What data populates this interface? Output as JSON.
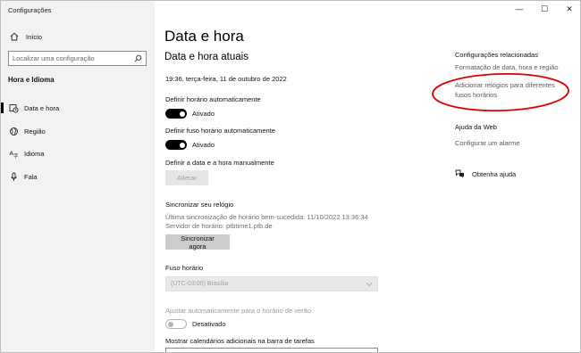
{
  "app": {
    "title": "Configurações"
  },
  "window_controls": {
    "minimize": "—",
    "maximize": "☐",
    "close": "✕"
  },
  "sidebar": {
    "home_label": "Início",
    "search_placeholder": "Localizar uma configuração",
    "section_title": "Hora e Idioma",
    "items": [
      {
        "label": "Data e hora",
        "icon": "calendar-clock-icon",
        "active": true
      },
      {
        "label": "Região",
        "icon": "globe-icon",
        "active": false
      },
      {
        "label": "Idioma",
        "icon": "language-icon",
        "active": false
      },
      {
        "label": "Fala",
        "icon": "microphone-icon",
        "active": false
      }
    ]
  },
  "main": {
    "page_title": "Data e hora",
    "current_section_title": "Data e hora atuais",
    "current_datetime": "19:36, terça-feira, 11 de outubro de 2022",
    "auto_time": {
      "label": "Definir horário automaticamente",
      "state": "Ativado"
    },
    "auto_timezone": {
      "label": "Definir fuso horário automaticamente",
      "state": "Ativado"
    },
    "manual": {
      "label": "Definir a data e a hora manualmente",
      "button": "Alterar"
    },
    "sync": {
      "title": "Sincronizar seu relógio",
      "last_sync": "Última sincronização de horário bem-sucedida: 11/10/2022 13:36:34",
      "server": "Servidor de horário: ptbtime1.ptb.de",
      "button": "Sincronizar agora"
    },
    "timezone": {
      "label": "Fuso horário",
      "value": "(UTC-03:00) Brasília"
    },
    "dst": {
      "label": "Ajustar automaticamente para o horário de verão",
      "state": "Desativado"
    },
    "extra_calendars_label": "Mostrar calendários adicionais na barra de tarefas"
  },
  "related": {
    "title": "Configurações relacionadas",
    "format_link": "Formatação de data, hora e região",
    "clocks_link": "Adicionar relógios para diferentes fusos horários",
    "help_title": "Ajuda da Web",
    "alarm_link": "Configurar um alarme",
    "get_help": "Obtenha ajuda"
  },
  "colors": {
    "sidebar_bg": "#f2f2f2",
    "annotation": "#e00000",
    "toggle_on": "#000000"
  }
}
